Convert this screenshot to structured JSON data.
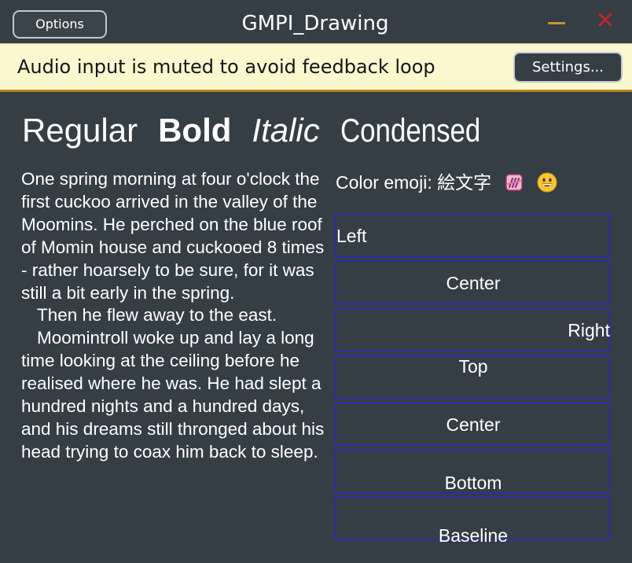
{
  "window": {
    "title": "GMPI_Drawing",
    "options_label": "Options",
    "minimize_icon": "minimize-icon",
    "close_icon": "close-icon",
    "close_glyph": "✕"
  },
  "banner": {
    "message": "Audio input is muted to avoid feedback loop",
    "settings_label": "Settings..."
  },
  "font_styles": {
    "regular": "Regular",
    "bold": "Bold",
    "italic": "Italic",
    "condensed": "Condensed"
  },
  "story": {
    "paragraph_1": "One spring morning at four o'clock the first cuckoo arrived in the valley of the Moomins. He perched on the blue roof of Momin house and cuckooed 8 times - rather hoarsely to be sure, for it was still a bit early in the spring.",
    "paragraph_2": "Then he flew away to the east.",
    "paragraph_3": "Moomintroll woke up and lay a long time looking at the ceiling before he realised where he was. He had slept a hundred nights and a hundred days, and his dreams still thronged about his head trying to coax him back to sleep."
  },
  "emoji": {
    "label": "Color emoji: 絵文字",
    "icons": [
      "hand-icon",
      "grinning-face-icon"
    ]
  },
  "alignment": {
    "left": "Left",
    "center_h": "Center",
    "right": "Right",
    "top": "Top",
    "center_v": "Center",
    "bottom": "Bottom",
    "baseline": "Baseline"
  },
  "colors": {
    "background": "#353d45",
    "banner_background": "#fbf7cf",
    "banner_border": "#b9861f",
    "box_border": "#1f1fff",
    "minimize": "#c9922c",
    "close": "#c0272d"
  }
}
